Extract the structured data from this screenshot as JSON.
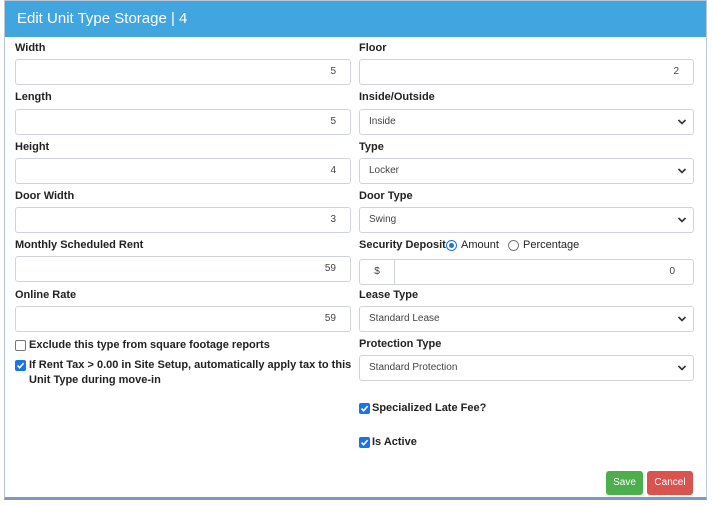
{
  "header": {
    "title": "Edit Unit Type Storage | 4"
  },
  "left": {
    "width": {
      "label": "Width",
      "value": "5"
    },
    "length": {
      "label": "Length",
      "value": "5"
    },
    "height": {
      "label": "Height",
      "value": "4"
    },
    "door_width": {
      "label": "Door Width",
      "value": "3"
    },
    "monthly_rent": {
      "label": "Monthly Scheduled Rent",
      "value": "59"
    },
    "online_rate": {
      "label": "Online Rate",
      "value": "59"
    },
    "exclude_sqft": {
      "label": "Exclude this type from square footage reports",
      "checked": false
    },
    "rent_tax": {
      "label": "If Rent Tax > 0.00 in Site Setup, automatically apply tax to this Unit Type during move-in",
      "checked": true
    }
  },
  "right": {
    "floor": {
      "label": "Floor",
      "value": "2"
    },
    "inside_outside": {
      "label": "Inside/Outside",
      "selected": "Inside"
    },
    "type": {
      "label": "Type",
      "selected": "Locker"
    },
    "door_type": {
      "label": "Door Type",
      "selected": "Swing"
    },
    "security_deposit": {
      "label": "Security Deposit",
      "option_amount": "Amount",
      "option_percentage": "Percentage",
      "selected": "Amount",
      "prefix": "$",
      "value": "0"
    },
    "lease_type": {
      "label": "Lease Type",
      "selected": "Standard Lease"
    },
    "protection_type": {
      "label": "Protection Type",
      "selected": "Standard Protection"
    },
    "specialized_late_fee": {
      "label": "Specialized Late Fee?",
      "checked": true
    },
    "is_active": {
      "label": "Is Active",
      "checked": true
    }
  },
  "footer": {
    "save_label": "Save",
    "cancel_label": "Cancel"
  },
  "colors": {
    "header": "#41a5e0",
    "save": "#4cae4c",
    "cancel": "#d9534f",
    "check": "#1a73e8"
  }
}
